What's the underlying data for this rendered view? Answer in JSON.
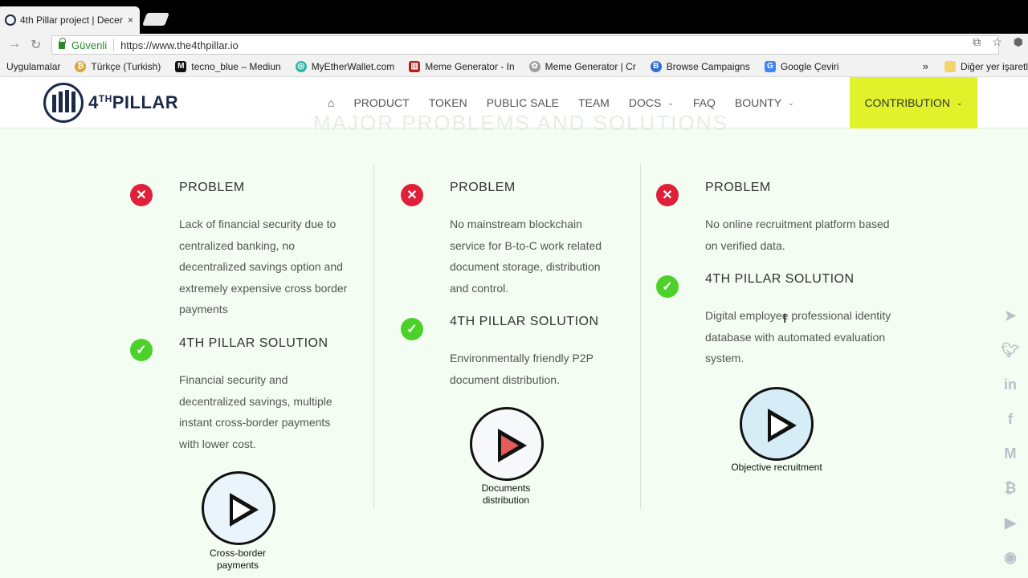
{
  "browser": {
    "tab_title": "4th Pillar project | Decen",
    "tab_close": "×",
    "secure_label": "Güvenli",
    "url": "https://www.the4thpillar.io",
    "bookmarks": [
      {
        "label": "Uygulamalar",
        "icon": "apps-icon"
      },
      {
        "label": "Türkçe (Turkish)",
        "icon": "coin-icon"
      },
      {
        "label": "tecno_blue – Mediun",
        "icon": "medium-icon"
      },
      {
        "label": "MyEtherWallet.com",
        "icon": "myetherwallet-icon"
      },
      {
        "label": "Meme Generator - In",
        "icon": "meme-icon"
      },
      {
        "label": "Meme Generator | Cr",
        "icon": "meme-cr-icon"
      },
      {
        "label": "Browse Campaigns",
        "icon": "bitcoin-icon"
      },
      {
        "label": "Google Çeviri",
        "icon": "google-translate-icon"
      }
    ],
    "bookmarks_more": "»",
    "other_bookmarks": "Diğer yer işaretl"
  },
  "site": {
    "logo_text": "PILLAR",
    "logo_prefix": "4",
    "logo_sup": "TH",
    "nav": [
      "PRODUCT",
      "TOKEN",
      "PUBLIC SALE",
      "TEAM",
      "DOCS",
      "FAQ",
      "BOUNTY"
    ],
    "contribution": "CONTRIBUTION",
    "accent": "#e2f22a",
    "ghost_title": "MAJOR PROBLEMS AND SOLUTIONS"
  },
  "columns": [
    {
      "problem_heading": "PROBLEM",
      "problem_text": "Lack of financial security due to centralized banking, no decentralized savings option and extremely expensive cross border payments",
      "solution_heading": "4TH PILLAR SOLUTION",
      "solution_text": "Financial security and decentralized savings, multiple instant cross-border payments with lower cost.",
      "video_caption": "Cross-border payments"
    },
    {
      "problem_heading": "PROBLEM",
      "problem_text": "No mainstream blockchain service for B-to-C work related document storage, distribution and control.",
      "solution_heading": "4TH PILLAR SOLUTION",
      "solution_text": "Environmentally friendly P2P document distribution.",
      "video_caption": "Documents distribution"
    },
    {
      "problem_heading": "PROBLEM",
      "problem_text": "No online recruitment platform based on verified data.",
      "solution_heading": "4TH PILLAR SOLUTION",
      "solution_text": "Digital employee professional identity database with automated evaluation system.",
      "video_caption": "Objective recruitment"
    }
  ],
  "colors": {
    "problem": "#e0203a",
    "solution": "#4cd12a",
    "background": "#f3fdf1"
  },
  "social": [
    "telegram-icon",
    "twitter-icon",
    "linkedin-icon",
    "facebook-icon",
    "medium-icon",
    "bitcoin-icon",
    "youtube-icon",
    "github-icon"
  ]
}
